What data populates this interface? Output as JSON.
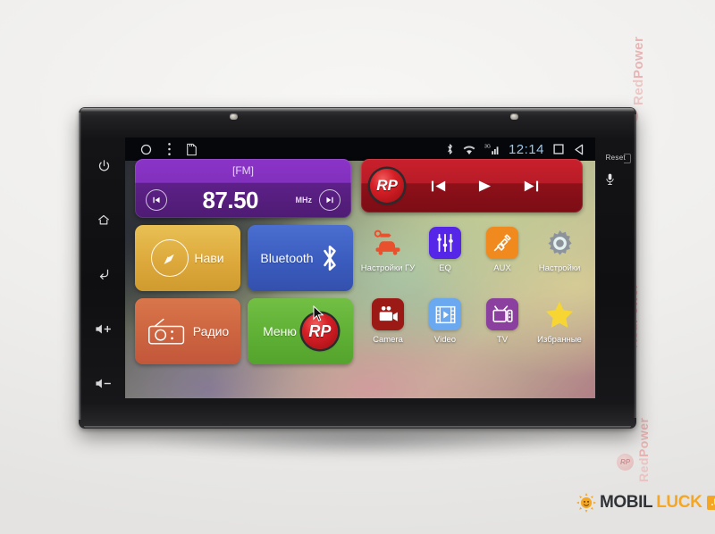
{
  "device": {
    "brand_watermark": "RedPower",
    "left_keys": [
      {
        "name": "power",
        "icon": "power-icon"
      },
      {
        "name": "home",
        "icon": "home-icon"
      },
      {
        "name": "back",
        "icon": "back-arrow-icon"
      },
      {
        "name": "volume_up",
        "icon": "volume-up-icon",
        "label": "+"
      },
      {
        "name": "volume_down",
        "icon": "volume-down-icon",
        "label": "-"
      }
    ],
    "right_bezel": {
      "reset_label": "Reset",
      "mic_icon": "microphone-icon"
    }
  },
  "statusbar": {
    "left_icons": [
      "home-circle-icon",
      "overflow-menu-icon",
      "sd-card-icon"
    ],
    "right_icons": [
      "bluetooth-icon",
      "wifi-icon",
      "signal-3g-icon"
    ],
    "clock": "12:14",
    "nav_icons": [
      "recents-square-icon",
      "back-triangle-icon"
    ]
  },
  "fm_panel": {
    "band": "[FM]",
    "frequency": "87.50",
    "unit": "MHz",
    "prev_icon": "seek-prev-icon",
    "next_icon": "seek-next-icon"
  },
  "player_panel": {
    "logo_text": "RP",
    "prev_icon": "track-prev-icon",
    "play_icon": "play-icon",
    "next_icon": "track-next-icon"
  },
  "tiles": [
    {
      "id": "navi",
      "label": "Нави",
      "icon": "compass-icon",
      "color": "#dda93c"
    },
    {
      "id": "bluetooth",
      "label": "Bluetooth",
      "icon": "bluetooth-icon",
      "color": "#3a5cbe"
    },
    {
      "id": "radio",
      "label": "Радио",
      "icon": "radio-icon",
      "color": "#cc6440"
    },
    {
      "id": "menu",
      "label": "Меню",
      "icon": "rp-logo-icon",
      "color": "#5fb035"
    }
  ],
  "apps": [
    {
      "id": "unit-settings",
      "label": "Настройки ГУ",
      "icon": "car-wrench-icon",
      "color": "#e8502e"
    },
    {
      "id": "eq",
      "label": "EQ",
      "icon": "equalizer-icon",
      "color": "#5526e8"
    },
    {
      "id": "aux",
      "label": "AUX",
      "icon": "aux-jack-icon",
      "color": "#f08a1e"
    },
    {
      "id": "settings",
      "label": "Настройки",
      "icon": "gear-icon",
      "color": "#8d939b"
    },
    {
      "id": "camera",
      "label": "Camera",
      "icon": "camcorder-icon",
      "color": "#9c1a16"
    },
    {
      "id": "video",
      "label": "Video",
      "icon": "filmstrip-icon",
      "color": "#6aa8ef"
    },
    {
      "id": "tv",
      "label": "TV",
      "icon": "television-icon",
      "color": "#8b3f9e"
    },
    {
      "id": "favorites",
      "label": "Избранные",
      "icon": "star-icon",
      "color": "#f7d633"
    }
  ],
  "footer_logo": {
    "mobil": "MOBIL",
    "luck": "LUCK",
    "tld": ".UA",
    "sun_icon": "sun-icon"
  }
}
